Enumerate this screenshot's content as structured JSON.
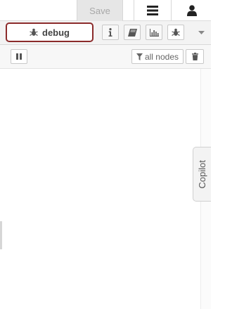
{
  "header": {
    "save_label": "Save",
    "menu_icon": "hamburger-icon",
    "user_icon": "user-icon"
  },
  "sidebar_tabs": {
    "active_tab_label": "debug",
    "active_tab_icon": "bug-icon",
    "tab_icons": [
      "info-icon",
      "book-icon",
      "chart-icon",
      "bug-icon"
    ],
    "more_icon": "caret-down-icon"
  },
  "toolbar": {
    "pause_icon": "pause-icon",
    "filter_label": "all nodes",
    "filter_icon": "filter-icon",
    "clear_icon": "trash-icon"
  },
  "copilot": {
    "label": "Copilot"
  },
  "colors": {
    "active_tab_border": "#8b2b2b",
    "save_bg": "#e6e6e6",
    "save_text": "#a8a8a8"
  }
}
